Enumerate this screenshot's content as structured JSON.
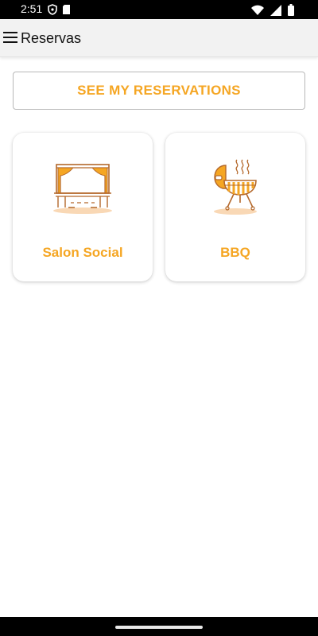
{
  "status_bar": {
    "time": "2:51",
    "icons": [
      "shield-icon",
      "sd-card-icon",
      "wifi-icon",
      "signal-icon",
      "battery-icon"
    ]
  },
  "app_bar": {
    "title": "Reservas",
    "menu_icon": "hamburger-menu-icon"
  },
  "reservations_button": {
    "label": "SEE MY RESERVATIONS"
  },
  "amenities": [
    {
      "label": "Salon Social",
      "icon": "stage-curtain-icon"
    },
    {
      "label": "BBQ",
      "icon": "bbq-grill-icon"
    }
  ],
  "colors": {
    "accent": "#f5a623",
    "accent_light": "#f9d8b5",
    "icon_outline": "#b4682b",
    "status_bar": "#000000",
    "app_bar": "#f2f2f2"
  }
}
